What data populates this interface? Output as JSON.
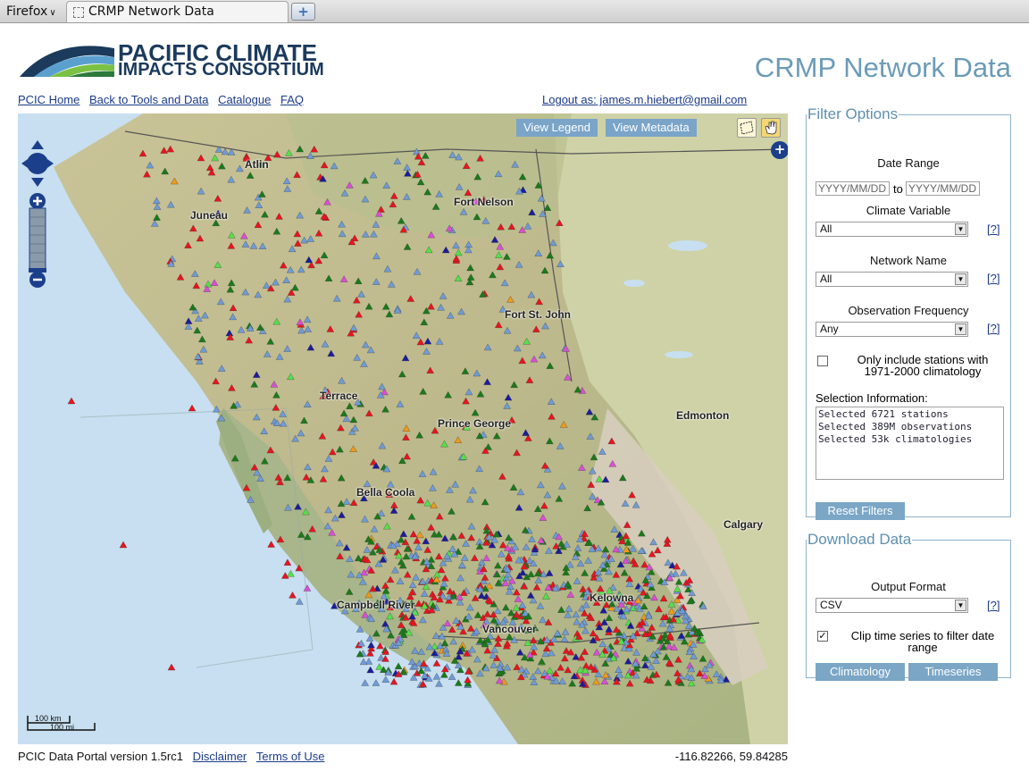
{
  "browser": {
    "menu_label": "Firefox",
    "tab_title": "CRMP Network Data",
    "new_tab_label": "+"
  },
  "header": {
    "logo_line1": "PACIFIC CLIMATE",
    "logo_line2": "IMPACTS CONSORTIUM",
    "page_title": "CRMP Network Data"
  },
  "nav": {
    "links": [
      "PCIC Home",
      "Back to Tools and Data",
      "Catalogue",
      "FAQ"
    ],
    "logout": "Logout as: james.m.hiebert@gmail.com"
  },
  "map": {
    "view_legend": "View Legend",
    "view_metadata": "View Metadata",
    "places": [
      "Atlin",
      "Juneau",
      "Fort Nelson",
      "Fort St. John",
      "Terrace",
      "Prince George",
      "Edmonton",
      "Bella Coola",
      "Calgary",
      "Campbell River",
      "Vancouver",
      "Kelowna"
    ],
    "scale_km": "100 km",
    "scale_mi": "100 mi",
    "marker_colors": {
      "blue": "#6f9bd6",
      "red": "#e8141e",
      "green": "#1a7a1a",
      "magenta": "#d94fd4",
      "navy": "#1c1c9a",
      "lime": "#55e04a",
      "orange": "#f09a18"
    }
  },
  "filter": {
    "legend": "Filter Options",
    "date_range_label": "Date Range",
    "date_start_placeholder": "YYYY/MM/DD",
    "date_to": "to",
    "date_end_placeholder": "YYYY/MM/DD",
    "climate_variable_label": "Climate Variable",
    "climate_variable_value": "All",
    "network_name_label": "Network Name",
    "network_name_value": "All",
    "obs_freq_label": "Observation Frequency",
    "obs_freq_value": "Any",
    "help": "[?]",
    "climatology_checkbox_label": "Only include stations with 1971-2000 climatology",
    "climatology_checked": false,
    "selection_info_label": "Selection Information:",
    "selection_info": [
      "Selected 6721 stations",
      "Selected 389M observations",
      "Selected 53k climatologies"
    ],
    "reset_button": "Reset Filters"
  },
  "download": {
    "legend": "Download Data",
    "output_format_label": "Output Format",
    "output_format_value": "CSV",
    "help": "[?]",
    "clip_label": "Clip time series to filter date range",
    "clip_checked": true,
    "climatology_button": "Climatology",
    "timeseries_button": "Timeseries"
  },
  "footer": {
    "version": "PCIC Data Portal version 1.5rc1",
    "disclaimer": "Disclaimer",
    "terms": "Terms of Use",
    "coords": "-116.82266, 59.84285"
  }
}
